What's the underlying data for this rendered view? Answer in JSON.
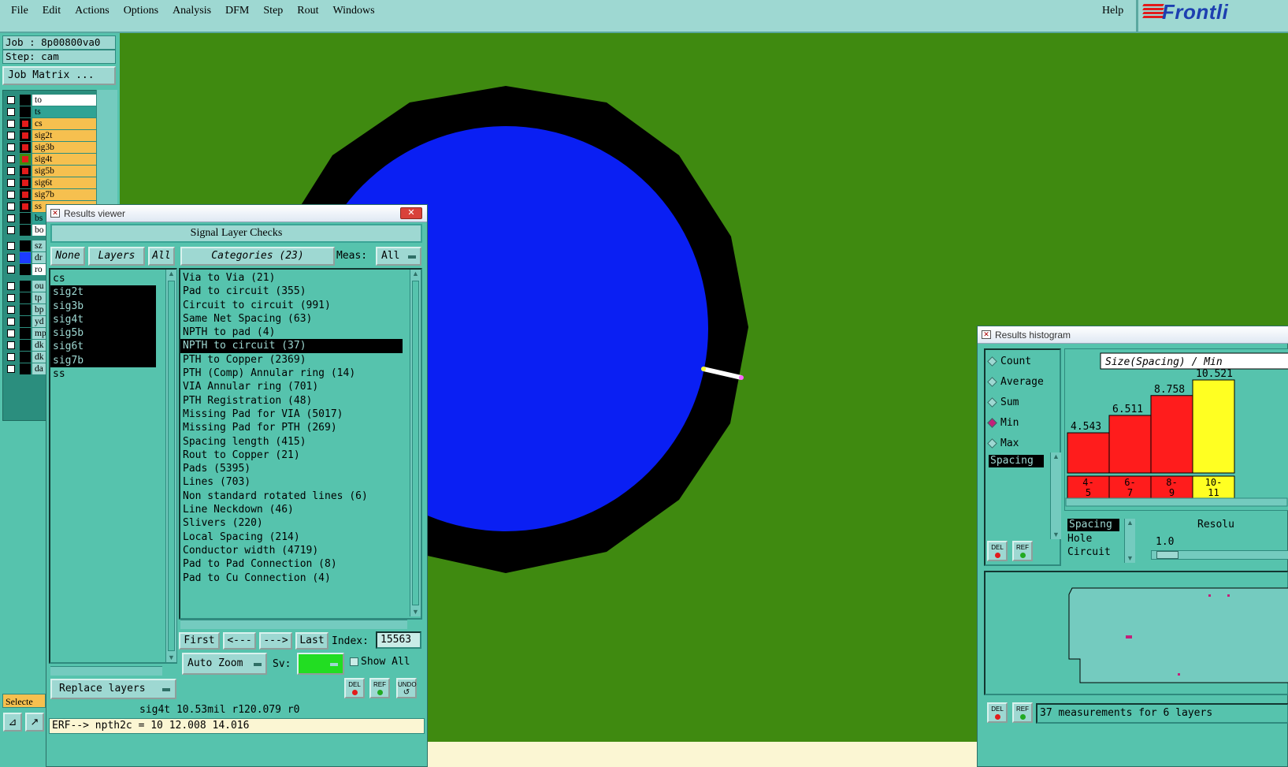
{
  "menu": {
    "items": [
      "File",
      "Edit",
      "Actions",
      "Options",
      "Analysis",
      "DFM",
      "Step",
      "Rout",
      "Windows"
    ],
    "help": "Help",
    "logo_text": "Frontli"
  },
  "left_panel": {
    "job_label": "Job  : 8p00800va0",
    "step_label": "Step: cam",
    "job_matrix_button": "Job Matrix ...",
    "layers": [
      {
        "name": "to",
        "swatch": "#000000",
        "name_bg": "#ffffff",
        "checked": false
      },
      {
        "name": "ts",
        "swatch": "#000000",
        "name_bg": "#2fa394",
        "checked": false
      },
      {
        "name": "cs",
        "swatch": "#000000",
        "name_bg": "#f6c04f",
        "checked": true
      },
      {
        "name": "sig2t",
        "swatch": "#000000",
        "name_bg": "#f6c04f",
        "checked": true
      },
      {
        "name": "sig3b",
        "swatch": "#000000",
        "name_bg": "#f6c04f",
        "checked": true
      },
      {
        "name": "sig4t",
        "swatch": "#3f8a10",
        "name_bg": "#f6c04f",
        "checked": true
      },
      {
        "name": "sig5b",
        "swatch": "#000000",
        "name_bg": "#f6c04f",
        "checked": true
      },
      {
        "name": "sig6t",
        "swatch": "#000000",
        "name_bg": "#f6c04f",
        "checked": true
      },
      {
        "name": "sig7b",
        "swatch": "#000000",
        "name_bg": "#f6c04f",
        "checked": true
      },
      {
        "name": "ss",
        "swatch": "#000000",
        "name_bg": "#f6c04f",
        "checked": true
      },
      {
        "name": "bs",
        "swatch": "#000000",
        "name_bg": "#2fa394",
        "checked": false
      },
      {
        "name": "bo",
        "swatch": "#000000",
        "name_bg": "#ffffff",
        "checked": false
      },
      {
        "name": "sz",
        "swatch": "#000000",
        "name_bg": "#9ed8d2",
        "checked": false
      },
      {
        "name": "dr",
        "swatch": "#1c3cff",
        "name_bg": "#9ed8d2",
        "checked": false
      },
      {
        "name": "ro",
        "swatch": "#000000",
        "name_bg": "#ffffff",
        "checked": false
      },
      {
        "name": "ou",
        "swatch": "#000000",
        "name_bg": "#9ed8d2",
        "checked": false
      },
      {
        "name": "tp",
        "swatch": "#000000",
        "name_bg": "#9ed8d2",
        "checked": false
      },
      {
        "name": "bp",
        "swatch": "#000000",
        "name_bg": "#9ed8d2",
        "checked": false
      },
      {
        "name": "yd",
        "swatch": "#000000",
        "name_bg": "#9ed8d2",
        "checked": false
      },
      {
        "name": "mp",
        "swatch": "#000000",
        "name_bg": "#9ed8d2",
        "checked": false
      },
      {
        "name": "dk",
        "swatch": "#000000",
        "name_bg": "#9ed8d2",
        "checked": false
      },
      {
        "name": "dk",
        "swatch": "#000000",
        "name_bg": "#9ed8d2",
        "checked": false
      },
      {
        "name": "da",
        "swatch": "#000000",
        "name_bg": "#9ed8d2",
        "checked": false
      }
    ],
    "selected_label": "Selecte"
  },
  "results_viewer": {
    "title": "Results viewer",
    "header": "Signal Layer Checks",
    "none_button": "None",
    "layers_button": "Layers",
    "all_button": "All",
    "categories_button": "Categories (23)",
    "meas_label": "Meas:",
    "meas_value": "All",
    "layer_items": [
      {
        "label": "cs",
        "selected": false
      },
      {
        "label": "sig2t",
        "selected": true
      },
      {
        "label": "sig3b",
        "selected": true
      },
      {
        "label": "sig4t",
        "selected": true
      },
      {
        "label": "sig5b",
        "selected": true
      },
      {
        "label": "sig6t",
        "selected": true
      },
      {
        "label": "sig7b",
        "selected": true
      },
      {
        "label": "ss",
        "selected": false
      }
    ],
    "categories": [
      {
        "label": "Via to Via (21)",
        "selected": false
      },
      {
        "label": "Pad to circuit (355)",
        "selected": false
      },
      {
        "label": "Circuit to circuit (991)",
        "selected": false
      },
      {
        "label": "Same Net Spacing (63)",
        "selected": false
      },
      {
        "label": "NPTH to pad (4)",
        "selected": false
      },
      {
        "label": "NPTH to circuit (37)",
        "selected": true
      },
      {
        "label": "PTH to Copper (2369)",
        "selected": false
      },
      {
        "label": "PTH (Comp) Annular ring (14)",
        "selected": false
      },
      {
        "label": "VIA Annular ring (701)",
        "selected": false
      },
      {
        "label": "PTH Registration (48)",
        "selected": false
      },
      {
        "label": "Missing Pad for VIA (5017)",
        "selected": false
      },
      {
        "label": "Missing Pad for PTH (269)",
        "selected": false
      },
      {
        "label": "Spacing length (415)",
        "selected": false
      },
      {
        "label": "Rout to Copper (21)",
        "selected": false
      },
      {
        "label": "Pads (5395)",
        "selected": false
      },
      {
        "label": "Lines (703)",
        "selected": false
      },
      {
        "label": "Non standard rotated lines (6)",
        "selected": false
      },
      {
        "label": "Line Neckdown (46)",
        "selected": false
      },
      {
        "label": "Slivers (220)",
        "selected": false
      },
      {
        "label": "Local Spacing (214)",
        "selected": false
      },
      {
        "label": "Conductor width (4719)",
        "selected": false
      },
      {
        "label": "Pad to Pad Connection (8)",
        "selected": false
      },
      {
        "label": "Pad to Cu Connection (4)",
        "selected": false
      }
    ],
    "first_button": "First",
    "prev_button": "<---",
    "next_button": "--->",
    "last_button": "Last",
    "index_label": "Index:",
    "index_value": "15563",
    "auto_zoom_button": "Auto Zoom",
    "sv_label": "Sv:",
    "sv_color": "#22dd22",
    "show_all_label": "Show All",
    "replace_layers_button": "Replace layers",
    "del_label": "DEL",
    "ref_label": "REF",
    "undo_label": "UNDO",
    "info_line": "sig4t 10.53mil  r120.079  r0",
    "command_line": "ERF--> npth2c = 10 12.008 14.016"
  },
  "results_histogram": {
    "title": "Results histogram",
    "radio_options": [
      {
        "label": "Count",
        "selected": false
      },
      {
        "label": "Average",
        "selected": false
      },
      {
        "label": "Sum",
        "selected": false
      },
      {
        "label": "Min",
        "selected": true
      },
      {
        "label": "Max",
        "selected": false
      }
    ],
    "chart_title": "Size(Spacing) / Min",
    "bars": [
      {
        "value": "4.543",
        "value_num": 4.543,
        "bin_top": "4-",
        "bin_bottom": "5",
        "color": "#ff1c1c"
      },
      {
        "value": "6.511",
        "value_num": 6.511,
        "bin_top": "6-",
        "bin_bottom": "7",
        "color": "#ff1c1c"
      },
      {
        "value": "8.758",
        "value_num": 8.758,
        "bin_top": "8-",
        "bin_bottom": "9",
        "color": "#ff1c1c"
      },
      {
        "value": "10.521",
        "value_num": 10.521,
        "bin_top": "10-",
        "bin_bottom": "11",
        "color": "#ffff22"
      }
    ],
    "measure_list": [
      "Spacing"
    ],
    "type_list": [
      "Spacing",
      "Hole",
      "Circuit"
    ],
    "resolution_label": "Resolu",
    "resolution_value": "1.0",
    "del_label": "DEL",
    "ref_label": "REF",
    "status": "37 measurements for 6 layers"
  }
}
